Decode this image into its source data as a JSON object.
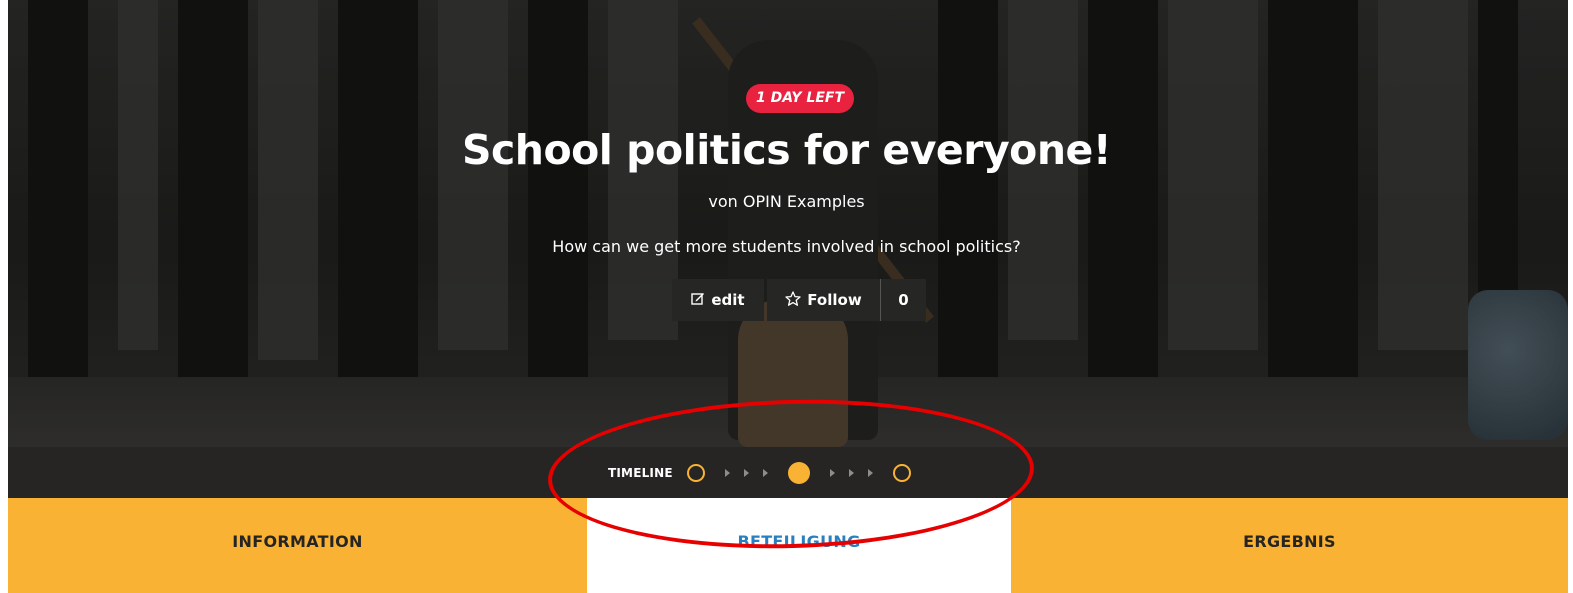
{
  "project": {
    "badge": "1 DAY LEFT",
    "title": "School politics for everyone!",
    "byline": "von OPIN Examples",
    "description": "How can we get more students involved in school politics?"
  },
  "actions": {
    "edit_icon": "pencil-square-icon",
    "edit_label": "edit",
    "follow_icon": "star-outline-icon",
    "follow_label": "Follow",
    "follow_count": "0"
  },
  "timeline": {
    "label": "TIMELINE",
    "phases": [
      {
        "state": "open"
      },
      {
        "state": "active"
      },
      {
        "state": "open"
      }
    ]
  },
  "tabs": [
    {
      "label": "INFORMATION",
      "active": false
    },
    {
      "label": "BETEILIGUNG",
      "active": true
    },
    {
      "label": "ERGEBNIS",
      "active": false
    }
  ],
  "colors": {
    "accent": "#f9b233",
    "badge": "#e8223f",
    "dark": "#262523",
    "active_tab_text": "#2a7fbf",
    "annotation": "#e60000"
  }
}
